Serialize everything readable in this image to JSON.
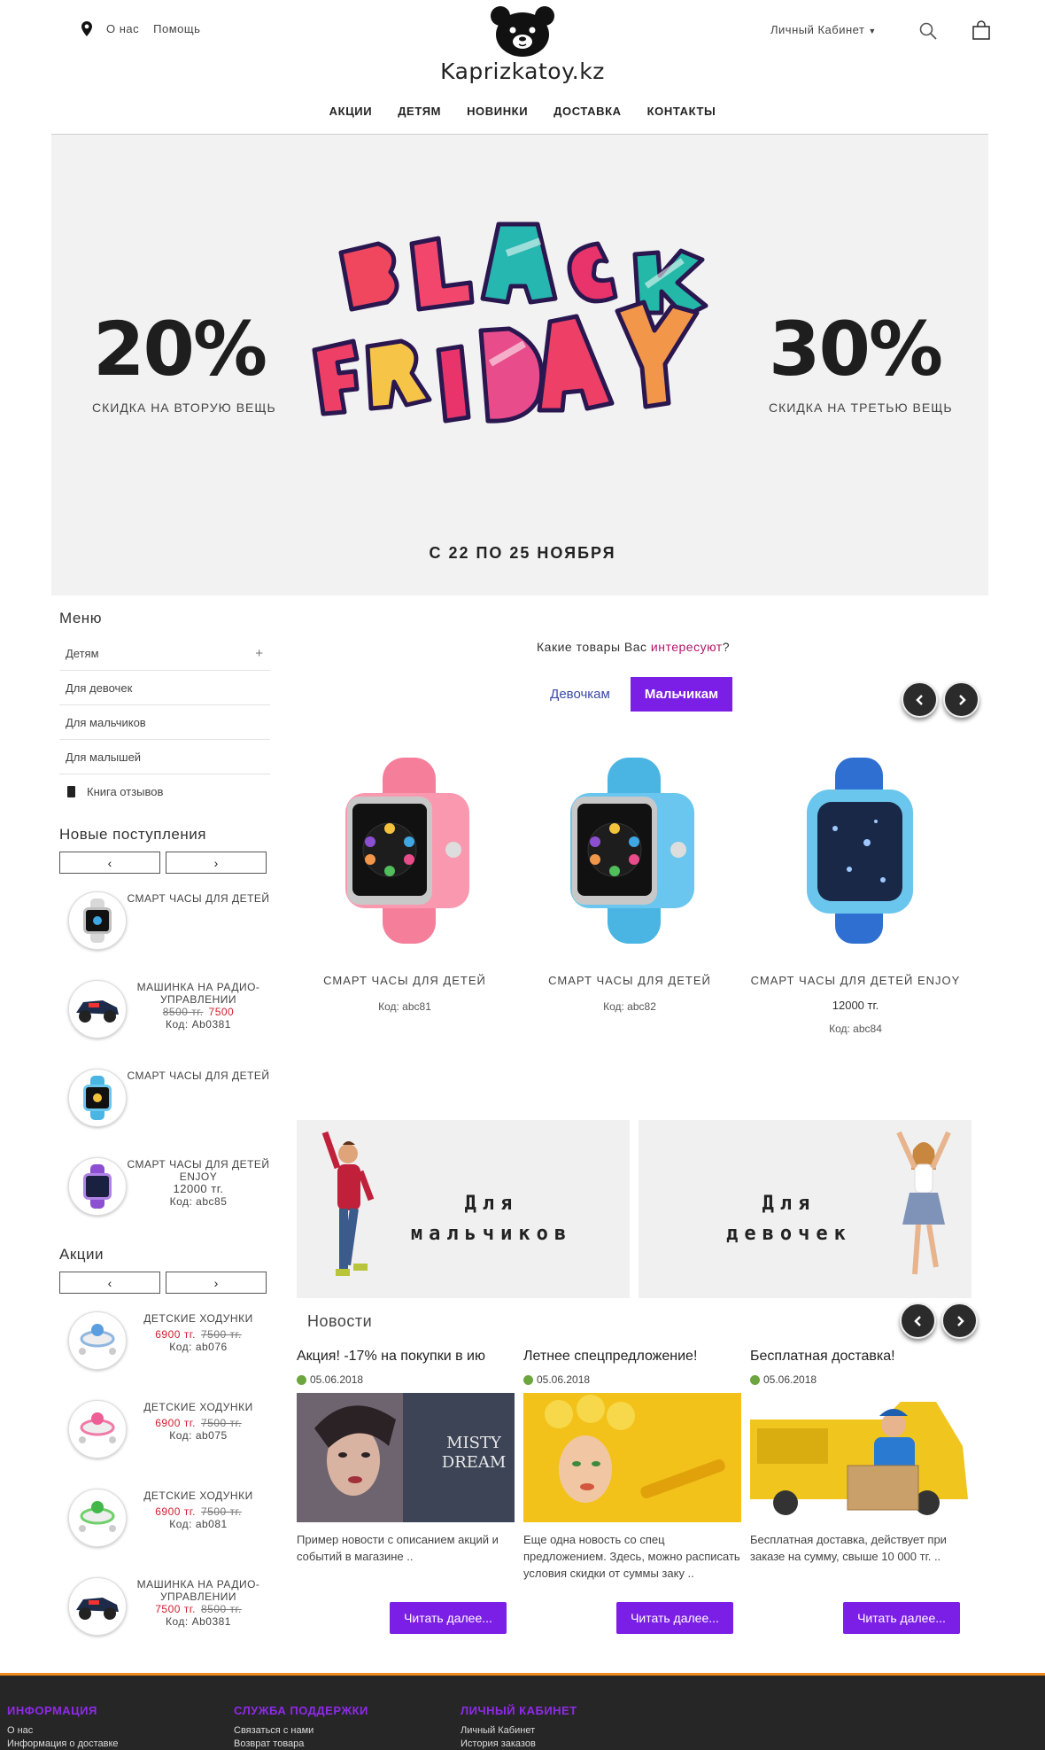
{
  "header": {
    "about": "О нас",
    "help": "Помощь",
    "logo_text": "Kaprizkatoy.kz",
    "account": "Личный Кабинет"
  },
  "nav": [
    "АКЦИИ",
    "ДЕТЯМ",
    "НОВИНКИ",
    "ДОСТАВКА",
    "КОНТАКТЫ"
  ],
  "hero": {
    "left_pct": "20%",
    "left_caption": "СКИДКА НА ВТОРУЮ ВЕЩЬ",
    "right_pct": "30%",
    "right_caption": "СКИДКА НА ТРЕТЬЮ ВЕЩЬ",
    "dates": "С 22 ПО 25 НОЯБРЯ"
  },
  "sidebar": {
    "menu_title": "Меню",
    "menu_items": [
      "Детям",
      "Для девочек",
      "Для мальчиков",
      "Для малышей",
      "Книга отзывов"
    ],
    "new_title": "Новые поступления",
    "promo_title": "Акции",
    "new_items": [
      {
        "name": "СМАРТ ЧАСЫ ДЛЯ ДЕТЕЙ"
      },
      {
        "name": "МАШИНКА НА РАДИО-УПРАВЛЕНИИ",
        "old": "8500 тг.",
        "price": "7500",
        "code": "Код: Ab0381"
      },
      {
        "name": "СМАРТ ЧАСЫ ДЛЯ ДЕТЕЙ"
      },
      {
        "name": "СМАРТ ЧАСЫ ДЛЯ ДЕТЕЙ ENJOY",
        "price_plain": "12000 тг.",
        "code": "Код: abc85"
      }
    ],
    "promo_items": [
      {
        "name": "ДЕТСКИЕ ХОДУНКИ",
        "price": "6900 тг.",
        "old": "7500 тг.",
        "code": "Код: ab076"
      },
      {
        "name": "ДЕТСКИЕ ХОДУНКИ",
        "price": "6900 тг.",
        "old": "7500 тг.",
        "code": "Код: ab075"
      },
      {
        "name": "ДЕТСКИЕ ХОДУНКИ",
        "price": "6900 тг.",
        "old": "7500 тг.",
        "code": "Код: ab081"
      },
      {
        "name": "МАШИНКА НА РАДИО-УПРАВЛЕНИИ",
        "price": "7500 тг.",
        "old": "8500 тг.",
        "code": "Код: Ab0381"
      }
    ]
  },
  "products": {
    "question_pre": "Какие товары Вас ",
    "question_hl": "интересуют",
    "question_post": "?",
    "tab_girls": "Девочкам",
    "tab_boys": "Мальчикам",
    "items": [
      {
        "name": "СМАРТ ЧАСЫ ДЛЯ ДЕТЕЙ",
        "price": "",
        "code": "Код: abc81",
        "color": "#f57f9b"
      },
      {
        "name": "СМАРТ ЧАСЫ ДЛЯ ДЕТЕЙ",
        "price": "",
        "code": "Код: abc82",
        "color": "#4ab5e3"
      },
      {
        "name": "СМАРТ ЧАСЫ ДЛЯ ДЕТЕЙ ENJOY",
        "price": "12000 тг.",
        "code": "Код: abc84",
        "color": "#2f6fd1"
      }
    ]
  },
  "categories": {
    "boys_line1": "Для",
    "boys_line2": "мальчиков",
    "girls_line1": "Для",
    "girls_line2": "девочек"
  },
  "news": {
    "title": "Новости",
    "read_more": "Читать далее...",
    "items": [
      {
        "headline": "Акция! -17% на покупки в ию",
        "date": "05.06.2018",
        "text": "Пример новости с описанием акций и событий в магазине ..",
        "misty": "MISTY",
        "dream": "DREAM"
      },
      {
        "headline": "Летнее спецпредложение!",
        "date": "05.06.2018",
        "text": "Еще одна новость со спец предложением. Здесь, можно расписать условия скидки от суммы заку .."
      },
      {
        "headline": "Бесплатная доставка!",
        "date": "05.06.2018",
        "text": "Бесплатная доставка, действует при заказе на сумму, свыше 10 000 тг. .."
      }
    ]
  },
  "footer": {
    "col1_title": "ИНФОРМАЦИЯ",
    "col1_links": [
      "О нас",
      "Информация о доставке"
    ],
    "col2_title": "СЛУЖБА ПОДДЕРЖКИ",
    "col2_links": [
      "Связаться с нами",
      "Возврат товара"
    ],
    "col3_title": "ЛИЧНЫЙ КАБИНЕТ",
    "col3_links": [
      "Личный Кабинет",
      "История заказов"
    ]
  },
  "colors": {
    "accent": "#7c1fe6",
    "price_red": "#d21c2c",
    "footer_bg": "#262626",
    "footer_line": "#f08a1c"
  }
}
